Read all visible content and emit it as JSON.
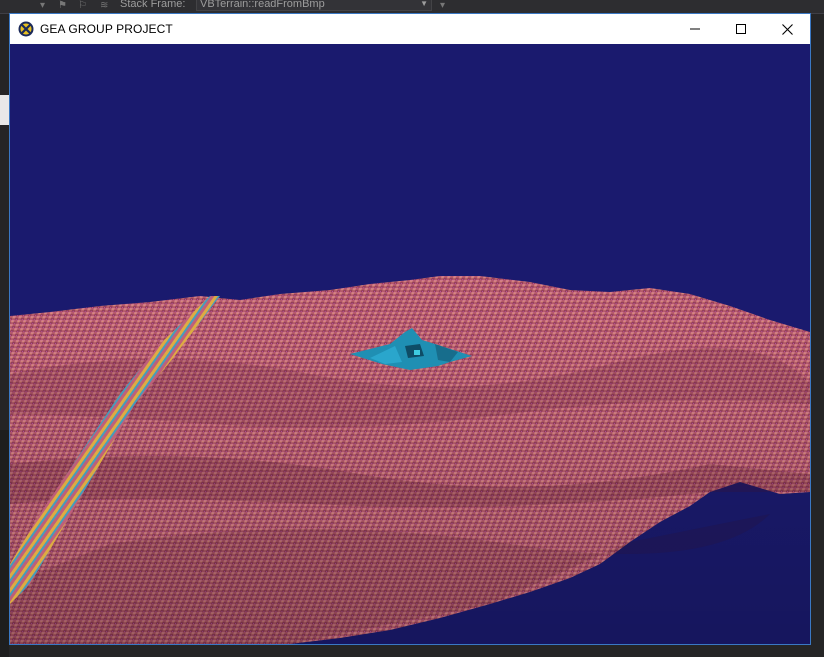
{
  "ide": {
    "stack_frame_label": "Stack Frame:",
    "stack_frame_value": "VBTerrain::readFromBmp"
  },
  "window": {
    "title": "GEA GROUP PROJECT",
    "icon": "app-logo-icon",
    "buttons": {
      "minimize": "minimize-icon",
      "maximize": "maximize-icon",
      "close": "close-icon"
    }
  },
  "scene": {
    "sky_color": "#1a1a6e",
    "terrain_color": "#b05a6a",
    "terrain_highlight": "#d97aa0",
    "terrain_shadow": "#6a2a3a",
    "object_color": "#1f8fb3",
    "ramp_colors": [
      "#e0b040",
      "#40a0c0",
      "#c060c0"
    ]
  }
}
